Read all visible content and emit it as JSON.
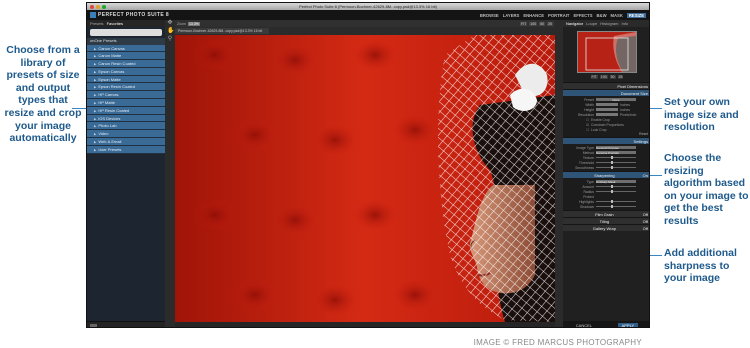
{
  "callouts": {
    "left": "Choose from a library of presets of size and output types that resize and crop your image automatically",
    "right1": "Set your own image size and resolution",
    "right2": "Choose the resizing algorithm based on your image to get the best results",
    "right3": "Add additional sharpness to your image"
  },
  "credit": "IMAGE © FRED MARCUS PHOTOGRAPHY",
  "app": {
    "window_title": "Perfect Photo Suite 8 (Permoon-Bochner-42629-8M- copy.psd@13.3% 16 bit)",
    "logo": "PERFECT PHOTO SUITE 8",
    "modes": [
      "BROWSE",
      "LAYERS",
      "ENHANCE",
      "PORTRAIT",
      "EFFECTS",
      "B&W",
      "MASK",
      "RESIZE"
    ]
  },
  "left_panel": {
    "tabs": [
      "Presets",
      "Favorites"
    ],
    "search_placeholder": "",
    "group": "onOne Presets",
    "presets": [
      "Canon Canvas",
      "Canon Matte",
      "Canon Resin Coated",
      "Epson Canvas",
      "Epson Matte",
      "Epson Resin Coated",
      "HP Canvas",
      "HP Matte",
      "HP Resin Coated",
      "iOS Devices",
      "Photo Lab",
      "Video",
      "Web & Email",
      "User Presets"
    ]
  },
  "toolbar": {
    "zoom_label": "Zoom",
    "zoom_value": "13.3%",
    "view_buttons": [
      "FIT",
      "100",
      "50",
      "25"
    ],
    "file_tab": "Permoon-Bochner-42629-8M- copy.psd@13.3% 16 bit"
  },
  "right_panel": {
    "nav_tabs": [
      "Navigator",
      "Loupe",
      "Histogram",
      "Info"
    ],
    "thumb_buttons": [
      "FIT",
      "100",
      "50",
      "25"
    ],
    "pixel_dimensions": "Pixel Dimensions",
    "document_size": {
      "title": "Document Size",
      "rows": [
        {
          "label": "Preset",
          "value": "None"
        },
        {
          "label": "Width",
          "value": "Inches"
        },
        {
          "label": "Height",
          "value": "Inches"
        },
        {
          "label": "Resolution",
          "value": "Pixels/Inch"
        }
      ],
      "checks": [
        "Enable Crop",
        "Constrain Proportions",
        "Lock Crop"
      ],
      "reset": "Reset"
    },
    "settings": {
      "title": "Settings",
      "rows": [
        {
          "label": "Image Type",
          "value": "General Purpose"
        },
        {
          "label": "Method",
          "value": "Genuine Fractals"
        },
        {
          "label": "Texture",
          "value": ""
        },
        {
          "label": "Threshold",
          "value": ""
        },
        {
          "label": "Smoothness",
          "value": ""
        }
      ]
    },
    "sharpening": {
      "title": "Sharpening",
      "state": "On",
      "rows": [
        {
          "label": "Type",
          "value": "Unsharp Mask"
        },
        {
          "label": "Amount",
          "value": ""
        },
        {
          "label": "Radius",
          "value": ""
        },
        {
          "label": "Protect",
          "value": ""
        },
        {
          "label": "Highlights",
          "value": ""
        },
        {
          "label": "Shadows",
          "value": ""
        }
      ]
    },
    "collapsed": [
      {
        "label": "Film Grain",
        "state": "Off"
      },
      {
        "label": "Tiling",
        "state": "Off"
      },
      {
        "label": "Gallery Wrap",
        "state": "Off"
      }
    ],
    "cancel": "CANCEL",
    "apply": "APPLY"
  }
}
